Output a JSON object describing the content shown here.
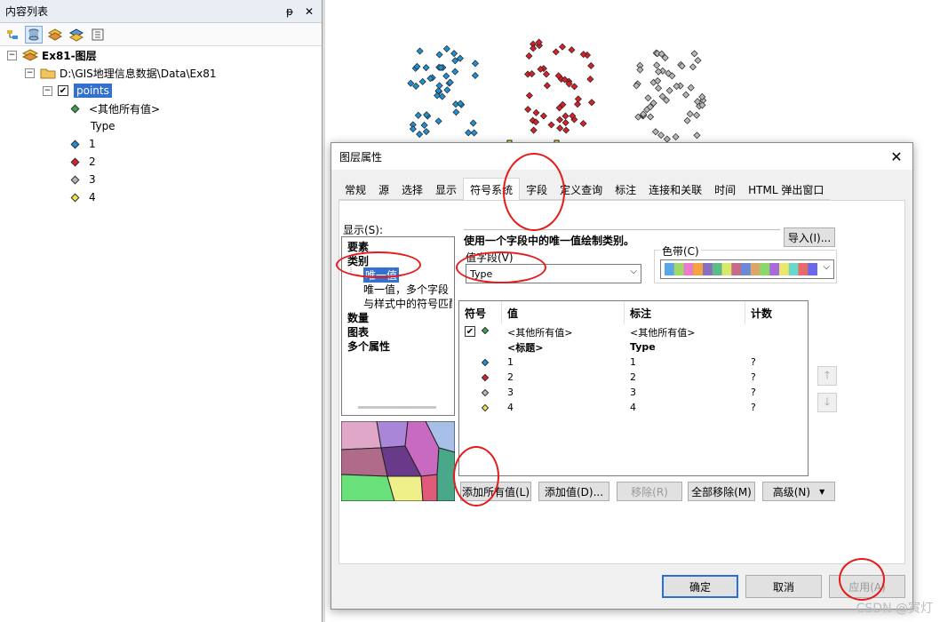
{
  "toc": {
    "title": "内容列表",
    "pin": "ᵽ",
    "close": "✕",
    "dataframe": "Ex81-图层",
    "folder": "D:\\GIS地理信息数据\\Data\\Ex81",
    "layer": "points",
    "others": "<其他所有值>",
    "field": "Type",
    "classes": [
      {
        "label": "1",
        "color": "#1f8fd6"
      },
      {
        "label": "2",
        "color": "#d6202a"
      },
      {
        "label": "3",
        "color": "#b8b8b8"
      },
      {
        "label": "4",
        "color": "#f0e34a"
      }
    ]
  },
  "dialog": {
    "title": "图层属性",
    "close": "✕",
    "tabs": [
      "常规",
      "源",
      "选择",
      "显示",
      "符号系统",
      "字段",
      "定义查询",
      "标注",
      "连接和关联",
      "时间",
      "HTML 弹出窗口"
    ],
    "active_tab": "符号系统",
    "show_label": "显示(S):",
    "show_items": [
      {
        "label": "要素",
        "bold": true
      },
      {
        "label": "类别",
        "bold": true
      },
      {
        "label": "唯一值",
        "selected": true
      },
      {
        "label": "唯一值，多个字段"
      },
      {
        "label": "与样式中的符号匹配"
      },
      {
        "label": "数量",
        "bold": true
      },
      {
        "label": "图表",
        "bold": true
      },
      {
        "label": "多个属性",
        "bold": true
      }
    ],
    "description": "使用一个字段中的唯一值绘制类别。",
    "import_button": "导入(I)...",
    "value_field_label": "值字段(V)",
    "value_field_value": "Type",
    "color_ramp_label": "色带(C)",
    "ramp_colors": [
      "#5aa7e8",
      "#a2d86a",
      "#e87cc8",
      "#f3a33f",
      "#8a6fbe",
      "#5fba8a",
      "#d8e86a",
      "#c86a8a",
      "#6a8ad8",
      "#d8a86a",
      "#8ad86a",
      "#a86ad8",
      "#e8e86a",
      "#6ad8c8",
      "#e86a6a",
      "#6a6ae8"
    ],
    "grid_headers": [
      "符号",
      "值",
      "标注",
      "计数"
    ],
    "grid_rows": [
      {
        "value": "<其他所有值>",
        "label": "<其他所有值>",
        "count": "",
        "checkbox": true,
        "color": "#3fa34d"
      },
      {
        "value": "<标题>",
        "label": "Type",
        "count": "",
        "bold": true
      },
      {
        "value": "1",
        "label": "1",
        "count": "?",
        "color": "#1f8fd6"
      },
      {
        "value": "2",
        "label": "2",
        "count": "?",
        "color": "#d6202a"
      },
      {
        "value": "3",
        "label": "3",
        "count": "?",
        "color": "#b8b8b8"
      },
      {
        "value": "4",
        "label": "4",
        "count": "?",
        "color": "#f0e34a"
      }
    ],
    "buttons": {
      "add_all": "添加所有值(L)",
      "add": "添加值(D)...",
      "remove": "移除(R)",
      "remove_all": "全部移除(M)",
      "advanced": "高级(N)"
    },
    "ok": "确定",
    "cancel": "取消",
    "apply": "应用(A)"
  },
  "watermark": "CSDN @寅灯"
}
